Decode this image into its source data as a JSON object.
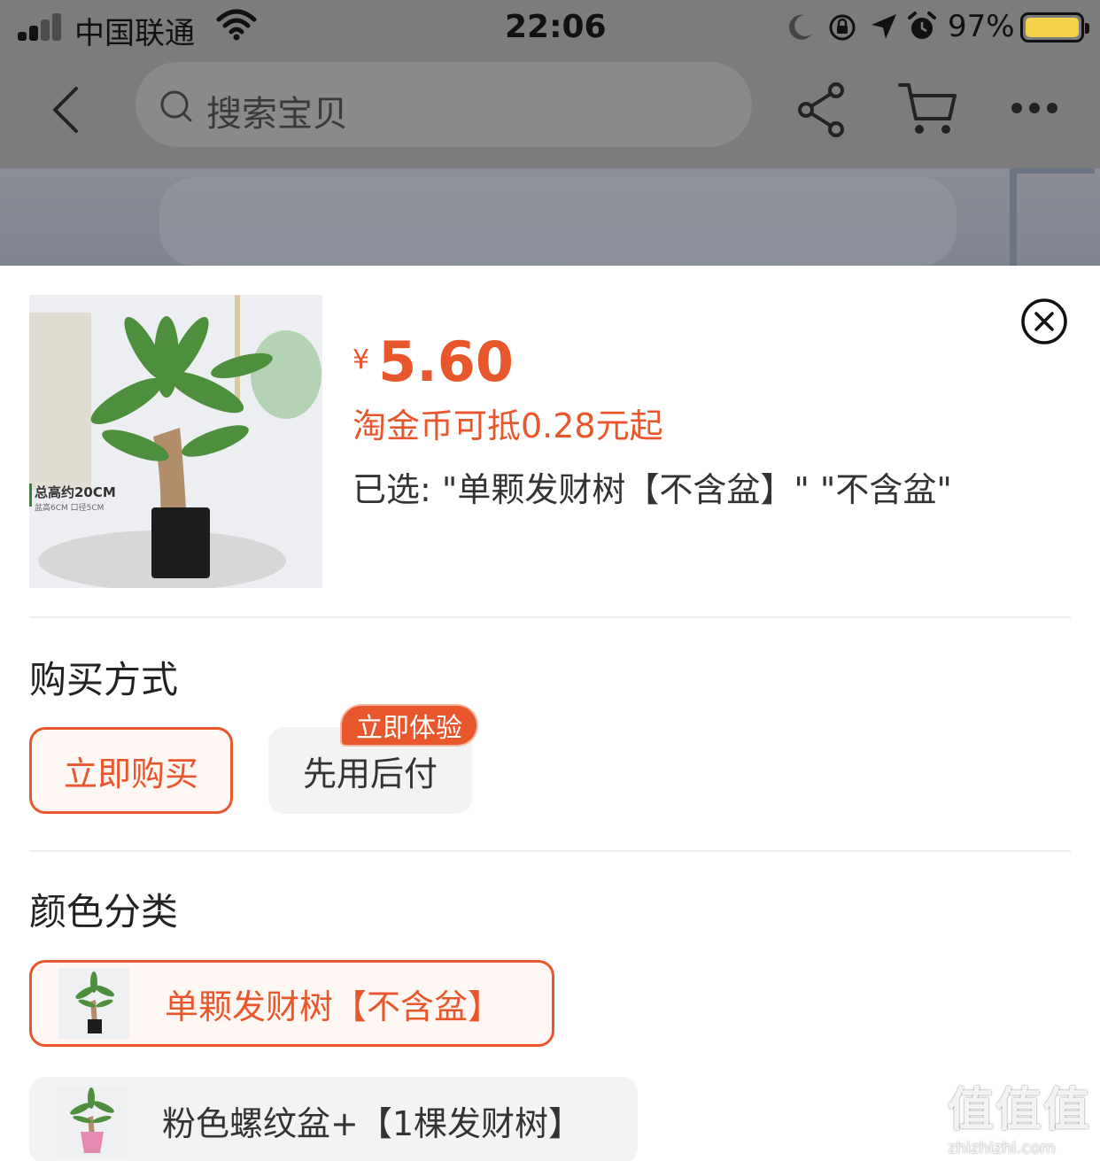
{
  "status_bar": {
    "carrier": "中国联通",
    "time": "22:06",
    "battery_percent": "97%",
    "battery_color": "#f5d24a"
  },
  "nav": {
    "search_placeholder": "搜索宝贝",
    "icons": [
      "back-arrow-icon",
      "search-icon",
      "share-icon",
      "cart-icon",
      "more-icon"
    ]
  },
  "product": {
    "image_caption_line1": "总高约20CM",
    "image_caption_line2": "盆高6CM  口径5CM",
    "currency_symbol": "¥",
    "price": "5.60",
    "coin_discount": "淘金币可抵0.28元起",
    "selected_text": "已选: \"单颗发财树【不含盆】\" \"不含盆\""
  },
  "purchase_method": {
    "title": "购买方式",
    "options": [
      {
        "label": "立即购买",
        "selected": true
      },
      {
        "label": "先用后付",
        "selected": false,
        "badge": "立即体验"
      }
    ]
  },
  "color_category": {
    "title": "颜色分类",
    "options": [
      {
        "label": "单颗发财树【不含盆】",
        "selected": true
      },
      {
        "label": "粉色螺纹盆+【1棵发财树】",
        "selected": false
      }
    ]
  },
  "watermark": {
    "main": "值值值",
    "sub": "zhizhizhi.com"
  },
  "colors": {
    "accent": "#e8562c",
    "overlay": "#7c7c7c"
  }
}
